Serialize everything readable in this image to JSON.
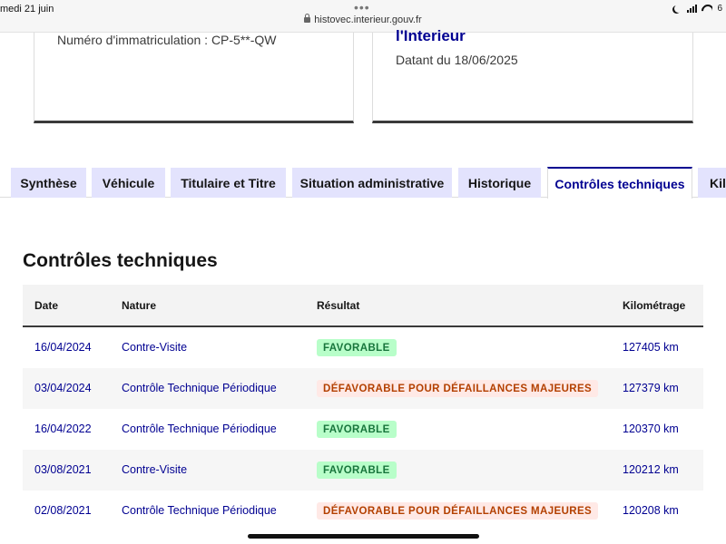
{
  "status_bar": {
    "time": "medi 21 juin",
    "dots": "•••",
    "url": "histovec.interieur.gouv.fr",
    "battery": "6"
  },
  "card_left": {
    "immatriculation": "Numéro d'immatriculation : CP-5**-QW"
  },
  "card_right": {
    "title": "l'Interieur",
    "date_line": "Datant du 18/06/2025"
  },
  "tabs": [
    {
      "label": "Synthèse"
    },
    {
      "label": "Véhicule"
    },
    {
      "label": "Titulaire et Titre"
    },
    {
      "label": "Situation administrative"
    },
    {
      "label": "Historique"
    },
    {
      "label": "Contrôles techniques"
    },
    {
      "label": "Kil"
    }
  ],
  "section": {
    "title": "Contrôles techniques"
  },
  "table": {
    "headers": [
      "Date",
      "Nature",
      "Résultat",
      "Kilométrage"
    ],
    "rows": [
      {
        "date": "16/04/2024",
        "nature": "Contre-Visite",
        "result": "FAVORABLE",
        "km": "127405 km"
      },
      {
        "date": "03/04/2024",
        "nature": "Contrôle Technique Périodique",
        "result": "DÉFAVORABLE POUR DÉFAILLANCES MAJEURES",
        "km": "127379 km"
      },
      {
        "date": "16/04/2022",
        "nature": "Contrôle Technique Périodique",
        "result": "FAVORABLE",
        "km": "120370 km"
      },
      {
        "date": "03/08/2021",
        "nature": "Contre-Visite",
        "result": "FAVORABLE",
        "km": "120212 km"
      },
      {
        "date": "02/08/2021",
        "nature": "Contrôle Technique Périodique",
        "result": "DÉFAVORABLE POUR DÉFAILLANCES MAJEURES",
        "km": "120208 km"
      }
    ]
  },
  "colors": {
    "primary": "#000091",
    "tab_bg": "#e3e3fd",
    "badge_good_bg": "#b8fec9",
    "badge_good_text": "#18753c",
    "badge_bad_bg": "#ffe9e6",
    "badge_bad_text": "#b34000"
  }
}
